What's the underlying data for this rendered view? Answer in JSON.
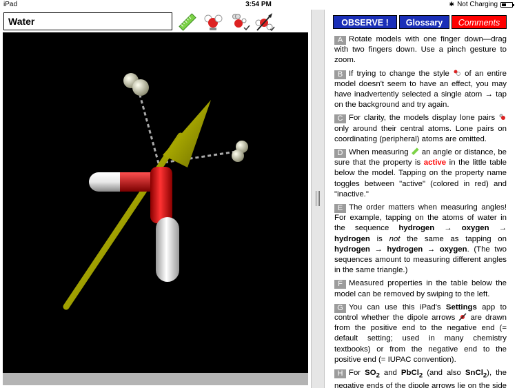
{
  "status": {
    "device": "iPad",
    "time": "3:54 PM",
    "charging": "Not Charging"
  },
  "molecule": {
    "name": "Water"
  },
  "tools": [
    {
      "icon": "ruler-icon",
      "label": "measure"
    },
    {
      "icon": "style-icon",
      "label": "style"
    },
    {
      "icon": "lone-pairs-icon",
      "label": "lone pairs"
    },
    {
      "icon": "dipole-icon",
      "label": "dipole"
    }
  ],
  "tabs": {
    "observe": "OBSERVE !",
    "glossary": "Glossary",
    "comments": "Comments"
  },
  "comments": {
    "a": {
      "letter": "A",
      "text": "Rotate models with one finger down—drag with two fingers down. Use a pinch gesture to zoom."
    },
    "b": {
      "letter": "B",
      "t1": "If trying to change the style",
      "t2": "of an entire model doesn't seem to have an effect, you may have inadvertently selected a single atom → tap on the background and try again."
    },
    "c": {
      "letter": "C",
      "t1": "For clarity, the models display lone pairs",
      "t2": "only around their central atoms. Lone pairs on coordinating (peripheral) atoms are omitted."
    },
    "d": {
      "letter": "D",
      "t1": "When measuring",
      "t2": "an angle or distance, be sure that the property is",
      "active": "active",
      "t3": "in the little table below the model. Tapping on the property name toggles between \"active\" (colored in red) and \"inactive.\""
    },
    "e": {
      "letter": "E",
      "t1": "The order matters when measuring angles! For example, tapping on the atoms of water in the sequence",
      "seq1": "hydrogen → oxygen → hydrogen",
      "t2": "is",
      "not": "not",
      "t3": "the same as tapping on",
      "seq2": "hydrogen → hydrogen → oxygen",
      "t4": ". (The two sequences amount to measuring different angles in the same triangle.)"
    },
    "f": {
      "letter": "F",
      "text": "Measured properties in the table below the model can be removed by swiping to the left."
    },
    "g": {
      "letter": "G",
      "t1": "You can use this iPad's",
      "settings": "Settings",
      "t2": "app to control whether the dipole arrows",
      "t3": "are drawn from the positive end to the negative end (= default setting; used in many chemistry textbooks) or from the negative end to the positive end (= IUPAC convention)."
    },
    "h": {
      "letter": "H",
      "t1": "For",
      "so": "SO",
      "so_sub": "2",
      "t2": "and",
      "pb": "PbCl",
      "pb_sub": "2",
      "t3": "(and also",
      "sn": "SnCl",
      "sn_sub": "2",
      "t4": "), the negative ends of the dipole arrows lie on the side of the non-bonded lone pairs."
    }
  }
}
